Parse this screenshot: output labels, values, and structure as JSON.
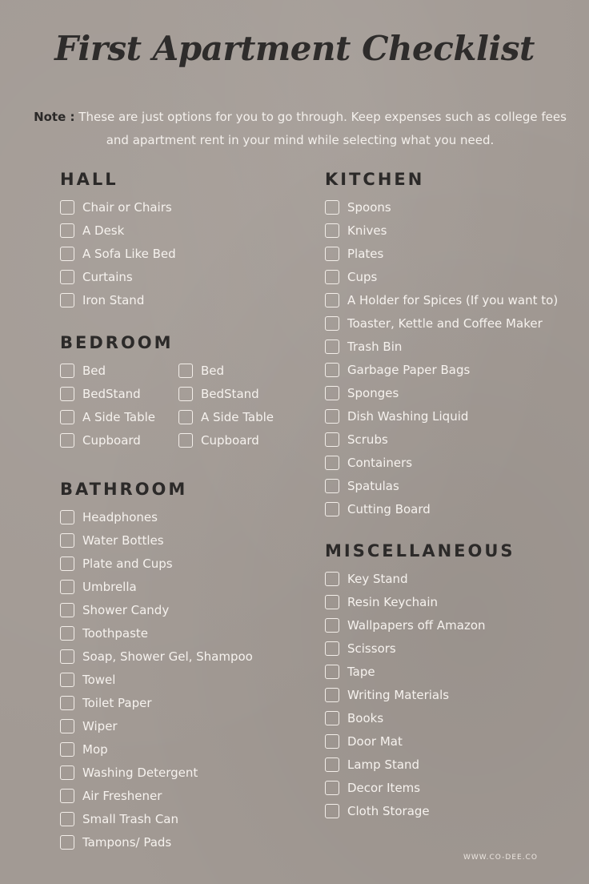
{
  "title": "First Apartment Checklist",
  "note": {
    "label": "Note :",
    "text": "These are just options for you to go through. Keep expenses such as college fees and apartment rent in your mind while selecting what you need."
  },
  "colors": {
    "background": "#a29a94",
    "heading": "#2c2a29",
    "item_text": "#f6f2ee"
  },
  "sections": {
    "hall": {
      "title": "HALL",
      "items": [
        "Chair or Chairs",
        "A Desk",
        "A Sofa Like Bed",
        "Curtains",
        "Iron Stand"
      ]
    },
    "bedroom": {
      "title": "BEDROOM",
      "columns": [
        [
          "Bed",
          "BedStand",
          "A Side Table",
          "Cupboard"
        ],
        [
          "Bed",
          "BedStand",
          "A Side Table",
          "Cupboard"
        ]
      ]
    },
    "bathroom": {
      "title": "BATHROOM",
      "items": [
        "Headphones",
        "Water Bottles",
        "Plate and Cups",
        "Umbrella",
        "Shower Candy",
        "Toothpaste",
        "Soap, Shower Gel, Shampoo",
        "Towel",
        "Toilet Paper",
        "Wiper",
        "Mop",
        "Washing Detergent",
        "Air Freshener",
        "Small Trash Can",
        "Tampons/ Pads"
      ]
    },
    "kitchen": {
      "title": "KITCHEN",
      "items": [
        "Spoons",
        "Knives",
        "Plates",
        "Cups",
        "A Holder for Spices (If you want to)",
        "Toaster, Kettle and Coffee Maker",
        "Trash Bin",
        "Garbage Paper Bags",
        "Sponges",
        "Dish Washing Liquid",
        "Scrubs",
        "Containers",
        "Spatulas",
        "Cutting Board"
      ]
    },
    "misc": {
      "title": "MISCELLANEOUS",
      "items": [
        "Key Stand",
        "Resin Keychain",
        "Wallpapers off Amazon",
        "Scissors",
        "Tape",
        "Writing Materials",
        "Books",
        "Door Mat",
        "Lamp Stand",
        "Decor Items",
        "Cloth Storage"
      ]
    }
  },
  "footer": "WWW.CO-DEE.CO"
}
